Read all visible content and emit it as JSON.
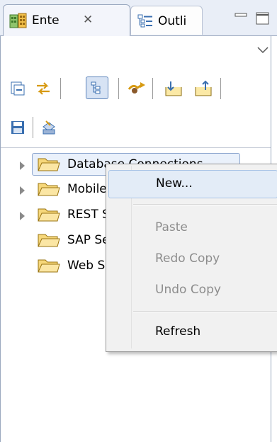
{
  "tabs": [
    {
      "label": "Ente",
      "close_glyph": "✕",
      "icon": "enterprise-explorer-icon",
      "active": true
    },
    {
      "label": "Outli",
      "icon": "outline-icon",
      "active": false
    }
  ],
  "window_controls": {
    "minimize": "minimize-icon",
    "maximize": "maximize-icon"
  },
  "toolbar": {
    "row1": [
      "collapse-all-icon",
      "link-with-editor-icon",
      "tree-layout-icon",
      "sync-icon",
      "import-icon",
      "export-icon"
    ],
    "row2": [
      "save-icon",
      "deploy-icon"
    ]
  },
  "tree": {
    "items": [
      {
        "label": "Database Connections",
        "expandable": true,
        "selected": true
      },
      {
        "label": "Mobile Business Objects",
        "expandable": true,
        "selected": false
      },
      {
        "label": "REST Services",
        "expandable": true,
        "selected": false
      },
      {
        "label": "SAP Servers",
        "expandable": false,
        "selected": false
      },
      {
        "label": "Web Services",
        "expandable": false,
        "selected": false
      }
    ]
  },
  "context_menu": {
    "items": [
      {
        "label": "New...",
        "enabled": true
      },
      {
        "label": "Paste",
        "enabled": false
      },
      {
        "label": "Redo Copy",
        "enabled": false
      },
      {
        "label": "Undo Copy",
        "enabled": false
      },
      {
        "label": "Refresh",
        "enabled": true
      }
    ]
  },
  "colors": {
    "tab_bar_bg": "#e9eef7",
    "selection_border": "#8ea7cf",
    "menu_bg": "#f1f1f1",
    "menu_hover": "#e3ecf7",
    "disabled_text": "#8d8d8d",
    "folder_fill": "#f6d77a"
  }
}
